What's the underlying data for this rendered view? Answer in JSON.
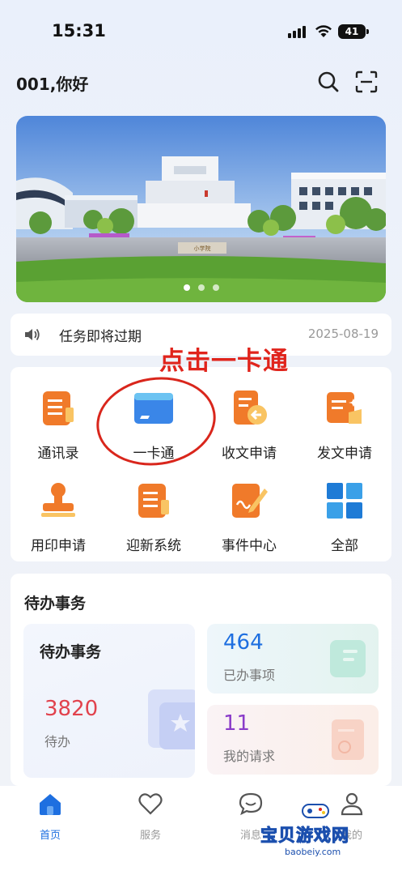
{
  "status_bar": {
    "time": "15:31",
    "battery": "41"
  },
  "header": {
    "greeting": "001,你好",
    "search_icon": "search-icon",
    "scan_icon": "scan-icon"
  },
  "banner": {
    "sign_text": "小学院",
    "slides": 3,
    "active_slide": 1
  },
  "notice": {
    "icon": "speaker-icon",
    "text": "任务即将过期",
    "date": "2025-08-19"
  },
  "annotation": {
    "text": "点击一卡通",
    "color": "#e0241c"
  },
  "apps": [
    {
      "label": "通讯录",
      "icon": "contacts-icon"
    },
    {
      "label": "一卡通",
      "icon": "card-icon"
    },
    {
      "label": "收文申请",
      "icon": "receive-doc-icon"
    },
    {
      "label": "发文申请",
      "icon": "send-doc-icon"
    },
    {
      "label": "用印申请",
      "icon": "stamp-icon"
    },
    {
      "label": "迎新系统",
      "icon": "welcome-system-icon"
    },
    {
      "label": "事件中心",
      "icon": "event-center-icon"
    },
    {
      "label": "全部",
      "icon": "grid-all-icon"
    }
  ],
  "todo": {
    "title": "待办事务",
    "main_card": {
      "title": "待办事务",
      "count": "3820",
      "label": "待办",
      "color": "#e1424d"
    },
    "done_card": {
      "count": "464",
      "label": "已办事项",
      "color": "#1e6fe0"
    },
    "request_card": {
      "count": "11",
      "label": "我的请求",
      "color": "#8a3cc9"
    }
  },
  "tabbar": {
    "items": [
      {
        "label": "首页",
        "icon": "home-icon",
        "active": true
      },
      {
        "label": "服务",
        "icon": "heart-icon",
        "active": false
      },
      {
        "label": "消息",
        "icon": "chat-icon",
        "active": false
      },
      {
        "label": "我的",
        "icon": "user-icon",
        "active": false
      }
    ]
  },
  "watermark": {
    "text": "宝贝游戏网",
    "url": "baobeiy.com"
  },
  "colors": {
    "accent": "#1e6fe0",
    "orange": "#f07a2a",
    "card_blue": "#3a86e8"
  }
}
